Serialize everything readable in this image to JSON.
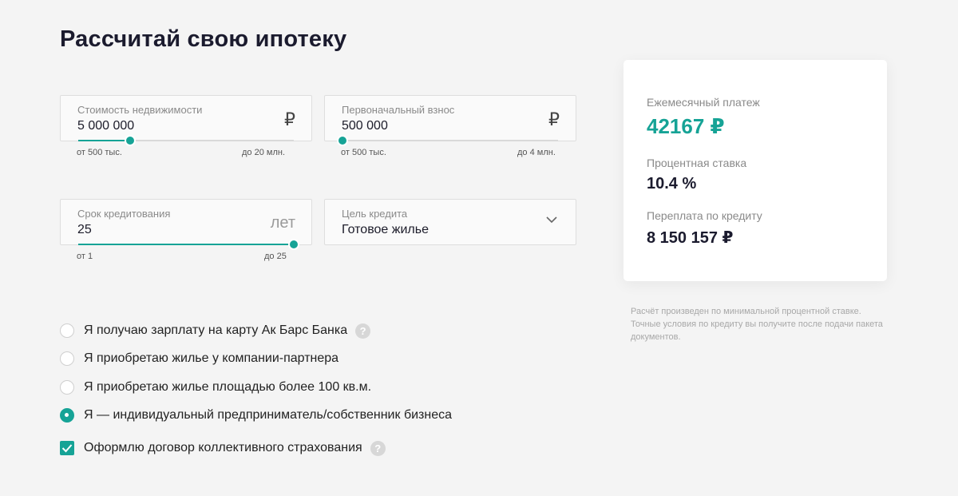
{
  "page": {
    "title": "Рассчитай свою ипотеку"
  },
  "fields": {
    "price": {
      "label": "Стоимость недвижимости",
      "value": "5 000 000",
      "unit": "₽",
      "min_label": "от 500 тыс.",
      "max_label": "до 20 млн.",
      "slider_fraction": 0.24
    },
    "down_payment": {
      "label": "Первоначальный взнос",
      "value": "500 000",
      "unit": "₽",
      "min_label": "от 500 тыс.",
      "max_label": "до 4 млн.",
      "slider_fraction": 0.0
    },
    "term": {
      "label": "Срок кредитования",
      "value": "25",
      "unit": "лет",
      "min_label": "от 1",
      "max_label": "до 25",
      "slider_fraction": 1.0
    },
    "purpose": {
      "label": "Цель кредита",
      "value": "Готовое жилье",
      "icon": "chevron-down-icon"
    }
  },
  "options": [
    {
      "label": "Я получаю зарплату на карту Ак Барс Банка",
      "checked": false,
      "help": "?"
    },
    {
      "label": "Я приобретаю жилье у компании-партнера",
      "checked": false
    },
    {
      "label": "Я приобретаю жилье площадью более 100 кв.м.",
      "checked": false
    },
    {
      "label": "Я — индивидуальный предприниматель/собственник бизнеса",
      "checked": true
    }
  ],
  "insurance": {
    "label": "Оформлю договор коллективного страхования",
    "checked": true,
    "help": "?"
  },
  "result": {
    "monthly_label": "Ежемесячный платеж",
    "monthly_value": "42167 ₽",
    "rate_label": "Процентная ставка",
    "rate_value": "10.4 %",
    "overpay_label": "Переплата по кредиту",
    "overpay_value": "8 150 157 ₽"
  },
  "note": "Расчёт произведен по минимальной процентной ставке. Точные условия по кредиту вы получите после подачи пакета документов.",
  "colors": {
    "accent": "#16a396",
    "background": "#f4f4f4"
  }
}
